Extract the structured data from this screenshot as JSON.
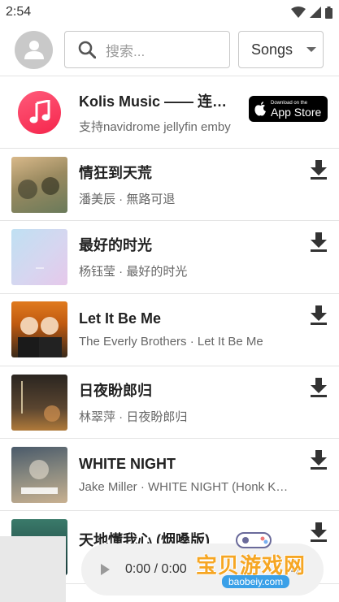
{
  "status_bar": {
    "time": "2:54"
  },
  "search": {
    "placeholder": "搜索..."
  },
  "filter": {
    "selected": "Songs"
  },
  "promo": {
    "title": "Kolis Music —— 连接音乐服务器",
    "subtitle": "支持navidrome jellyfin emby",
    "badge_small": "Download on the",
    "badge_big": "App Store"
  },
  "songs": [
    {
      "title": "情狂到天荒",
      "subtitle": "潘美辰 · 無路可退",
      "cover_colors": [
        "#d9b98a",
        "#6a7a5a"
      ]
    },
    {
      "title": "最好的时光",
      "subtitle": "杨钰莹 · 最好的时光",
      "cover_colors": [
        "#bfe0f2",
        "#e6c8ea"
      ]
    },
    {
      "title": "Let It Be Me",
      "subtitle": "The Everly Brothers · Let It Be Me",
      "cover_colors": [
        "#e07a1e",
        "#3a2a1a"
      ]
    },
    {
      "title": "日夜盼郎归",
      "subtitle": "林翠萍 · 日夜盼郎归",
      "cover_colors": [
        "#2a2520",
        "#b07a3a"
      ]
    },
    {
      "title": "WHITE NIGHT",
      "subtitle": "Jake Miller · WHITE NIGHT (Honk Kong Version)",
      "cover_colors": [
        "#4a5a6a",
        "#c8b090"
      ]
    },
    {
      "title": "天地懂我心 (烟嗓版)",
      "subtitle": "",
      "cover_colors": [
        "#3a7a6a",
        "#1a3a3a"
      ]
    }
  ],
  "player": {
    "time": "0:00 / 0:00"
  },
  "watermark": {
    "text": "宝贝游戏网",
    "url": "baobeiy.com"
  },
  "colors": {
    "accent": "#f5264c",
    "badge_bg": "#000000",
    "border": "#c8c8c8"
  }
}
